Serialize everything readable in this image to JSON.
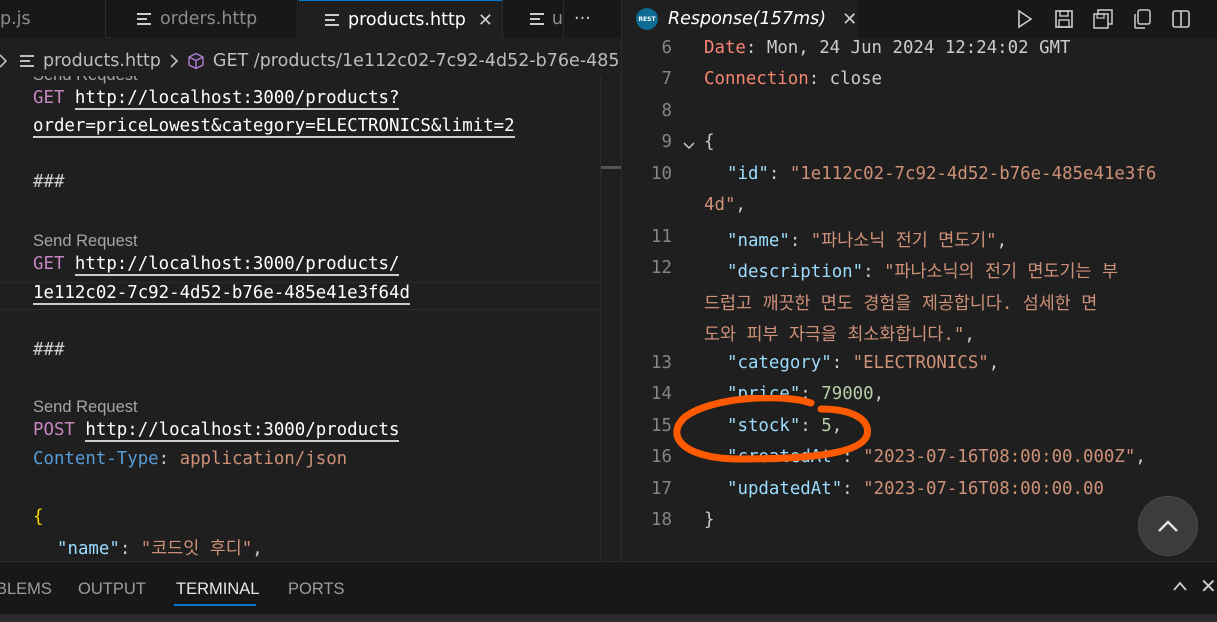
{
  "left_tabs": [
    {
      "label": "p.js"
    },
    {
      "label": "orders.http"
    },
    {
      "label": "products.http",
      "close": "✕"
    },
    {
      "label": "u"
    }
  ],
  "left_tabs_overflow": "···",
  "breadcrumb": {
    "file": "products.http",
    "symbol": "GET /products/1e112c02-7c92-4d52-b76e-485"
  },
  "left_code": {
    "codelens_partial": "Send Request",
    "req1_method": "GET",
    "req1_url_line1": "http://localhost:3000/products?",
    "req1_url_line2": "order=priceLowest&category=ELECTRONICS&limit=2",
    "sep1": "###",
    "codelens2": "Send Request",
    "req2_method": "GET",
    "req2_url_line1": "http://localhost:3000/products/",
    "req2_url_line2": "1e112c02-7c92-4d52-b76e-485e41e3f64d",
    "sep2": "###",
    "codelens3": "Send Request",
    "req3_method": "POST",
    "req3_url": "http://localhost:3000/products",
    "header_key": "Content-Type",
    "header_colon": ":",
    "header_value": "application/json",
    "body_open": "{",
    "body_key": "\"name\"",
    "body_colon": ": ",
    "body_value": "\"코드잇 후디\"",
    "body_comma": ","
  },
  "response_tab": {
    "icon_text": "REST",
    "label": "Response(157ms)",
    "close": "✕"
  },
  "response_lines": [
    {
      "num": "6",
      "key": "Date",
      "sep": ": ",
      "value": "Mon, 24 Jun 2024 12:24:02 GMT"
    },
    {
      "num": "7",
      "key": "Connection",
      "sep": ": ",
      "value": "close"
    },
    {
      "num": "8"
    },
    {
      "num": "9",
      "text": "{"
    },
    {
      "num": "10",
      "key": "\"id\"",
      "sep": ": ",
      "value": "\"1e112c02-7c92-4d52-b76e-485e41e3f6"
    },
    {
      "num": "",
      "value": "4d\"",
      "tail": ","
    },
    {
      "num": "11",
      "key": "\"name\"",
      "sep": ": ",
      "value": "\"파나소닉 전기 면도기\"",
      "tail": ","
    },
    {
      "num": "12",
      "key": "\"description\"",
      "sep": ": ",
      "value": "\"파나소닉의 전기 면도기는 부"
    },
    {
      "num": "",
      "value": "드럽고 깨끗한 면도 경험을 제공합니다. 섬세한 면"
    },
    {
      "num": "",
      "value": "도와 피부 자극을 최소화합니다.\"",
      "tail": ","
    },
    {
      "num": "13",
      "key": "\"category\"",
      "sep": ": ",
      "value": "\"ELECTRONICS\"",
      "tail": ","
    },
    {
      "num": "14",
      "key": "\"price\"",
      "sep": ": ",
      "value": "79000",
      "tail": ","
    },
    {
      "num": "15",
      "key": "\"stock\"",
      "sep": ": ",
      "value": "5",
      "tail": ","
    },
    {
      "num": "16",
      "key": "\"createdAt\"",
      "sep": ": ",
      "value": "\"2023-07-16T08:00:00.000Z\"",
      "tail": ","
    },
    {
      "num": "17",
      "key": "\"updatedAt\"",
      "sep": ": ",
      "value": "\"2023-07-16T08:00:00.00"
    },
    {
      "num": "18",
      "text": "}"
    }
  ],
  "panel_tabs": [
    {
      "label": "BLEMS"
    },
    {
      "label": "OUTPUT"
    },
    {
      "label": "TERMINAL"
    },
    {
      "label": "PORTS"
    }
  ],
  "panel_close": "✕",
  "colors": {
    "annotation": "#ff5a00",
    "accent": "#0078d4",
    "header_key": "#f48771",
    "json_key": "#9cdcfe",
    "json_string": "#ce9178",
    "json_number": "#b5cea8"
  },
  "icons": [
    "file-lines-icon",
    "cube-icon",
    "chevron-right-icon",
    "run-icon",
    "save-icon",
    "save-body-icon",
    "copy-icon",
    "split-icon",
    "chevron-up-icon",
    "close-icon"
  ]
}
